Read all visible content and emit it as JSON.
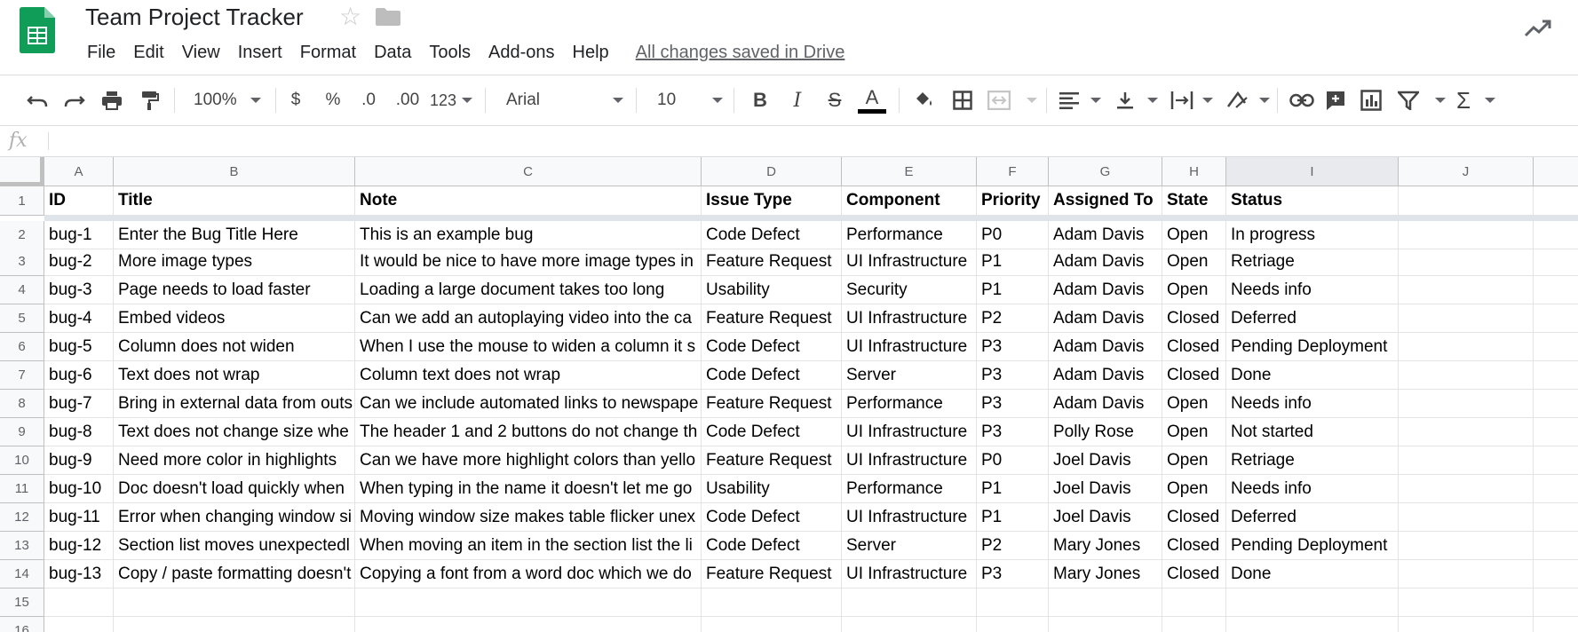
{
  "app": {
    "title": "Team Project Tracker",
    "save_status": "All changes saved in Drive",
    "accent_color": "#0f9d58"
  },
  "menu": [
    "File",
    "Edit",
    "View",
    "Insert",
    "Format",
    "Data",
    "Tools",
    "Add-ons",
    "Help"
  ],
  "toolbar": {
    "zoom": "100%",
    "currency": "$",
    "percent": "%",
    "decrease_decimal": ".0",
    "increase_decimal": ".00",
    "more_formats": "123",
    "font": "Arial",
    "font_size": "10",
    "bold": "B",
    "italic": "I",
    "strikethrough": "S",
    "text_color_glyph": "A",
    "text_color": "#000000",
    "icons": [
      "undo-icon",
      "redo-icon",
      "print-icon",
      "paint-format-icon",
      "fill-color-icon",
      "borders-icon",
      "merge-cells-icon",
      "align-left-icon",
      "vertical-align-icon",
      "text-wrap-icon",
      "text-rotate-icon",
      "link-icon",
      "comment-icon",
      "chart-icon",
      "filter-icon",
      "functions-icon"
    ]
  },
  "formula_bar": {
    "label": "fx",
    "value": ""
  },
  "grid": {
    "columns": [
      "A",
      "B",
      "C",
      "D",
      "E",
      "F",
      "G",
      "H",
      "I",
      "J"
    ],
    "selected_column": "I",
    "row_numbers": [
      "1",
      "2",
      "3",
      "4",
      "5",
      "6",
      "7",
      "8",
      "9",
      "10",
      "11",
      "12",
      "13",
      "14",
      "15",
      "16"
    ],
    "header_row": [
      "ID",
      "Title",
      "Note",
      "Issue Type",
      "Component",
      "Priority",
      "Assigned To",
      "State",
      "Status",
      ""
    ],
    "rows": [
      [
        "bug-1",
        "Enter the Bug Title Here",
        "This is an example bug",
        "Code Defect",
        "Performance",
        "P0",
        "Adam Davis",
        "Open",
        "In progress",
        ""
      ],
      [
        "bug-2",
        "More image types",
        "It would be nice to have more image types in",
        "Feature Request",
        "UI Infrastructure",
        "P1",
        "Adam Davis",
        "Open",
        "Retriage",
        ""
      ],
      [
        "bug-3",
        "Page needs to load faster",
        "Loading a large document takes too long",
        "Usability",
        "Security",
        "P1",
        "Adam Davis",
        "Open",
        "Needs info",
        ""
      ],
      [
        "bug-4",
        "Embed videos",
        "Can we add an autoplaying video into the ca",
        "Feature Request",
        "UI Infrastructure",
        "P2",
        "Adam Davis",
        "Closed",
        "Deferred",
        ""
      ],
      [
        "bug-5",
        "Column does not widen",
        "When I use the mouse to widen a column it s",
        "Code Defect",
        "UI Infrastructure",
        "P3",
        "Adam Davis",
        "Closed",
        "Pending Deployment",
        ""
      ],
      [
        "bug-6",
        "Text does not wrap",
        "Column text does not wrap",
        "Code Defect",
        "Server",
        "P3",
        "Adam Davis",
        "Closed",
        "Done",
        ""
      ],
      [
        "bug-7",
        "Bring in external data from outs",
        "Can we include automated links to newspape",
        "Feature Request",
        "Performance",
        "P3",
        "Adam Davis",
        "Open",
        "Needs info",
        ""
      ],
      [
        "bug-8",
        "Text does not change size whe",
        "The header 1 and 2 buttons do not change th",
        "Code Defect",
        "UI Infrastructure",
        "P3",
        "Polly Rose",
        "Open",
        "Not started",
        ""
      ],
      [
        "bug-9",
        "Need more color in highlights",
        "Can we have more highlight colors than yello",
        "Feature Request",
        "UI Infrastructure",
        "P0",
        "Joel Davis",
        "Open",
        "Retriage",
        ""
      ],
      [
        "bug-10",
        "Doc doesn't load quickly when",
        "When typing in the name it doesn't let me go",
        "Usability",
        "Performance",
        "P1",
        "Joel Davis",
        "Open",
        "Needs info",
        ""
      ],
      [
        "bug-11",
        "Error when changing window si",
        "Moving window size makes table flicker unex",
        "Code Defect",
        "UI Infrastructure",
        "P1",
        "Joel Davis",
        "Closed",
        "Deferred",
        ""
      ],
      [
        "bug-12",
        "Section list moves unexpectedl",
        "When moving an item in the section list the li",
        "Code Defect",
        "Server",
        "P2",
        "Mary Jones",
        "Closed",
        "Pending Deployment",
        ""
      ],
      [
        "bug-13",
        "Copy / paste formatting doesn't",
        "Copying a font from a word doc which we do",
        "Feature Request",
        "UI Infrastructure",
        "P3",
        "Mary Jones",
        "Closed",
        "Done",
        ""
      ],
      [
        "",
        "",
        "",
        "",
        "",
        "",
        "",
        "",
        "",
        ""
      ],
      [
        "",
        "",
        "",
        "",
        "",
        "",
        "",
        "",
        "",
        ""
      ]
    ]
  }
}
